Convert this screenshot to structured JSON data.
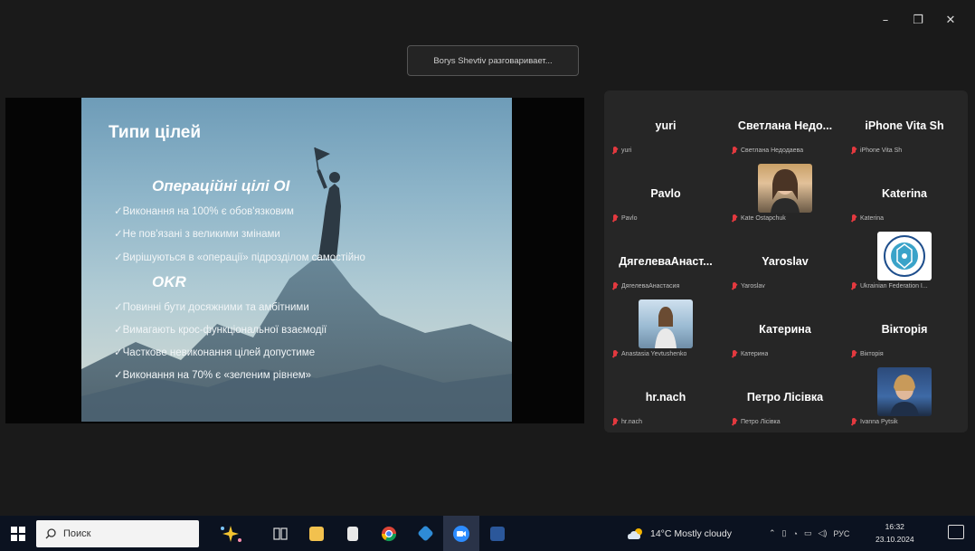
{
  "window": {
    "controls": {
      "minimize": "–",
      "restore": "❐",
      "close": "✕"
    }
  },
  "speaking_indicator": "Borys Shevtiv разговаривает...",
  "slide": {
    "title": "Типи цілей",
    "section1_heading": "Операційні  цілі OI",
    "section1_lines": [
      "✓Виконання на 100% є обов'язковим",
      "✓Не пов'язані з великими змінами",
      "✓Вирішуються в «операції» підрозділом самостійно"
    ],
    "section2_heading": "OKR",
    "section2_lines": [
      "✓Повинні бути досяжними та амбітними",
      "✓Вимагають крос-функціональної взаємодії",
      "✓Часткове невиконання цілей допустиме",
      "✓Виконання на 70% є «зеленим рівнем»"
    ]
  },
  "participants": [
    {
      "name": "yuri",
      "label": "yuri"
    },
    {
      "name": "Светлана  Недо...",
      "label": "Светлана Недодаева"
    },
    {
      "name": "iPhone Vita Sh",
      "label": "iPhone Vita Sh"
    },
    {
      "name": "Pavlo",
      "label": "Pavlo"
    },
    {
      "name": "",
      "label": "Kate Ostapchuk"
    },
    {
      "name": "Katerina",
      "label": "Katerina"
    },
    {
      "name": "ДягелеваАнаст...",
      "label": "ДягелеваАнастасия"
    },
    {
      "name": "Yaroslav",
      "label": "Yaroslav"
    },
    {
      "name": "",
      "label": "Ukrainian Federation I..."
    },
    {
      "name": "",
      "label": "Anastasia Yevtushenko"
    },
    {
      "name": "Катерина",
      "label": "Катерина"
    },
    {
      "name": "Вікторія",
      "label": "Вікторія"
    },
    {
      "name": "hr.nach",
      "label": "hr.nach"
    },
    {
      "name": "Петро Лісівка",
      "label": "Петро Лісівка"
    },
    {
      "name": "",
      "label": "Ivanna Pytsik"
    }
  ],
  "taskbar": {
    "search_placeholder": "Поиск",
    "weather": "14°C  Mostly cloudy",
    "language": "РУС",
    "time": "16:32",
    "date": "23.10.2024"
  },
  "colors": {
    "mic_muted": "#e3393f",
    "taskbar_bg": "#0b1220",
    "gallery_bg": "#262626"
  }
}
